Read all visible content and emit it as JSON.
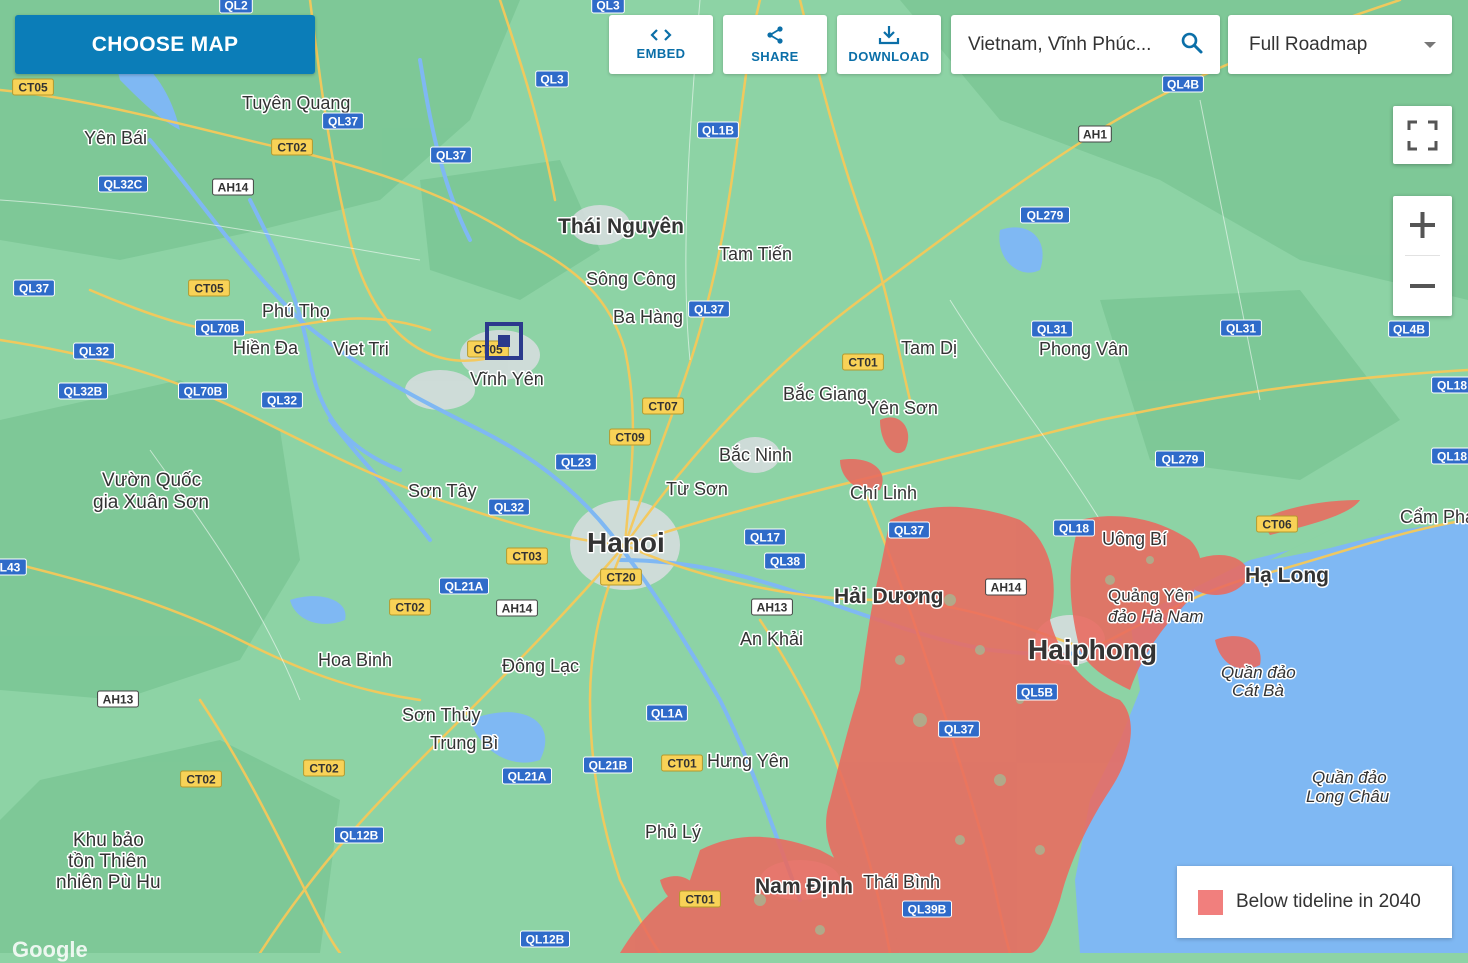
{
  "toolbar": {
    "choose_map": "CHOOSE MAP",
    "embed": "EMBED",
    "share": "SHARE",
    "download": "DOWNLOAD"
  },
  "search": {
    "value": "Vietnam, Vĩnh Phúc..."
  },
  "map_type": {
    "selected": "Full Roadmap"
  },
  "legend": {
    "label": "Below tideline in 2040",
    "color": "#f17f7d"
  },
  "colors": {
    "brand": "#0b7db8",
    "land": "#8dd3a5",
    "water": "#7fb8f3",
    "flood": "#ea6a5f",
    "road": "#f6c95a"
  },
  "cities": [
    {
      "name": "Hanoi",
      "major": true
    },
    {
      "name": "Haiphong",
      "major": true
    },
    {
      "name": "Thái Nguyên",
      "major": false
    },
    {
      "name": "Nam Định",
      "major": false
    },
    {
      "name": "Hải Dương",
      "major": false
    },
    {
      "name": "Hạ Long",
      "major": false
    },
    {
      "name": "Tuyên Quang",
      "major": false
    },
    {
      "name": "Yên Bái",
      "major": false
    },
    {
      "name": "Phú Thọ",
      "major": false
    },
    {
      "name": "Hiền Đa",
      "major": false
    },
    {
      "name": "Viet Tri",
      "major": false
    },
    {
      "name": "Vĩnh Yên",
      "major": false
    },
    {
      "name": "Sông Công",
      "major": false
    },
    {
      "name": "Tam Tiến",
      "major": false
    },
    {
      "name": "Ba Hàng",
      "major": false
    },
    {
      "name": "Tam Dị",
      "major": false
    },
    {
      "name": "Phong Vân",
      "major": false
    },
    {
      "name": "Bắc Giang",
      "major": false
    },
    {
      "name": "Yên Sơn",
      "major": false
    },
    {
      "name": "Bắc Ninh",
      "major": false
    },
    {
      "name": "Từ Sơn",
      "major": false
    },
    {
      "name": "Chí Linh",
      "major": false
    },
    {
      "name": "Sơn Tây",
      "major": false
    },
    {
      "name": "Vườn Quốc",
      "major": false
    },
    {
      "name": "gia Xuân Sơn",
      "major": false
    },
    {
      "name": "Uông Bí",
      "major": false
    },
    {
      "name": "Cẩm Pha",
      "major": false
    },
    {
      "name": "Quảng Yên",
      "major": false
    },
    {
      "name": "đảo Hà Nam",
      "major": false
    },
    {
      "name": "Quần đảo",
      "major": false
    },
    {
      "name": "Cát Bà",
      "major": false
    },
    {
      "name": "Long Châu",
      "major": false
    },
    {
      "name": "Hoa Binh",
      "major": false
    },
    {
      "name": "Đông Lạc",
      "major": false
    },
    {
      "name": "An Khải",
      "major": false
    },
    {
      "name": "Sơn Thủy",
      "major": false
    },
    {
      "name": "Trung Bì",
      "major": false
    },
    {
      "name": "Hưng Yên",
      "major": false
    },
    {
      "name": "Phủ Lý",
      "major": false
    },
    {
      "name": "Thái Bình",
      "major": false
    },
    {
      "name": "Khu bảo",
      "major": false
    },
    {
      "name": "tồn Thiên",
      "major": false
    },
    {
      "name": "nhiên Pù Hu",
      "major": false
    }
  ],
  "shields": [
    {
      "code": "CT05",
      "kind": "yellow"
    },
    {
      "code": "QL2",
      "kind": "blue"
    },
    {
      "code": "QL3",
      "kind": "blue"
    },
    {
      "code": "QL37",
      "kind": "blue"
    },
    {
      "code": "CT02",
      "kind": "yellow"
    },
    {
      "code": "QL32C",
      "kind": "blue"
    },
    {
      "code": "AH14",
      "kind": "white"
    },
    {
      "code": "QL37",
      "kind": "blue"
    },
    {
      "code": "QL3",
      "kind": "blue"
    },
    {
      "code": "QL1B",
      "kind": "blue"
    },
    {
      "code": "QL4B",
      "kind": "blue"
    },
    {
      "code": "AH1",
      "kind": "white"
    },
    {
      "code": "QL279",
      "kind": "blue"
    },
    {
      "code": "QL37",
      "kind": "blue"
    },
    {
      "code": "CT05",
      "kind": "yellow"
    },
    {
      "code": "QL70B",
      "kind": "blue"
    },
    {
      "code": "QL32",
      "kind": "blue"
    },
    {
      "code": "QL32B",
      "kind": "blue"
    },
    {
      "code": "QL70B",
      "kind": "blue"
    },
    {
      "code": "QL32",
      "kind": "blue"
    },
    {
      "code": "CT05",
      "kind": "yellow"
    },
    {
      "code": "QL37",
      "kind": "blue"
    },
    {
      "code": "CT01",
      "kind": "yellow"
    },
    {
      "code": "QL31",
      "kind": "blue"
    },
    {
      "code": "QL31",
      "kind": "blue"
    },
    {
      "code": "QL4B",
      "kind": "blue"
    },
    {
      "code": "QL18",
      "kind": "blue"
    },
    {
      "code": "CT07",
      "kind": "yellow"
    },
    {
      "code": "CT09",
      "kind": "yellow"
    },
    {
      "code": "QL23",
      "kind": "blue"
    },
    {
      "code": "QL279",
      "kind": "blue"
    },
    {
      "code": "QL18",
      "kind": "blue"
    },
    {
      "code": "QL32",
      "kind": "blue"
    },
    {
      "code": "QL37",
      "kind": "blue"
    },
    {
      "code": "QL18",
      "kind": "blue"
    },
    {
      "code": "CT06",
      "kind": "yellow"
    },
    {
      "code": "QL17",
      "kind": "blue"
    },
    {
      "code": "CT03",
      "kind": "yellow"
    },
    {
      "code": "QL38",
      "kind": "blue"
    },
    {
      "code": "CT20",
      "kind": "yellow"
    },
    {
      "code": "QL21A",
      "kind": "blue"
    },
    {
      "code": "AH14",
      "kind": "white"
    },
    {
      "code": "L43",
      "kind": "blue"
    },
    {
      "code": "CT02",
      "kind": "yellow"
    },
    {
      "code": "AH13",
      "kind": "white"
    },
    {
      "code": "AH14",
      "kind": "white"
    },
    {
      "code": "QL5B",
      "kind": "blue"
    },
    {
      "code": "AH13",
      "kind": "white"
    },
    {
      "code": "QL1A",
      "kind": "blue"
    },
    {
      "code": "QL37",
      "kind": "blue"
    },
    {
      "code": "QL21B",
      "kind": "blue"
    },
    {
      "code": "CT01",
      "kind": "yellow"
    },
    {
      "code": "CT02",
      "kind": "yellow"
    },
    {
      "code": "CT02",
      "kind": "yellow"
    },
    {
      "code": "QL21A",
      "kind": "blue"
    },
    {
      "code": "QL12B",
      "kind": "blue"
    },
    {
      "code": "CT01",
      "kind": "yellow"
    },
    {
      "code": "QL39B",
      "kind": "blue"
    },
    {
      "code": "QL12B",
      "kind": "blue"
    }
  ],
  "attribution": "Google"
}
